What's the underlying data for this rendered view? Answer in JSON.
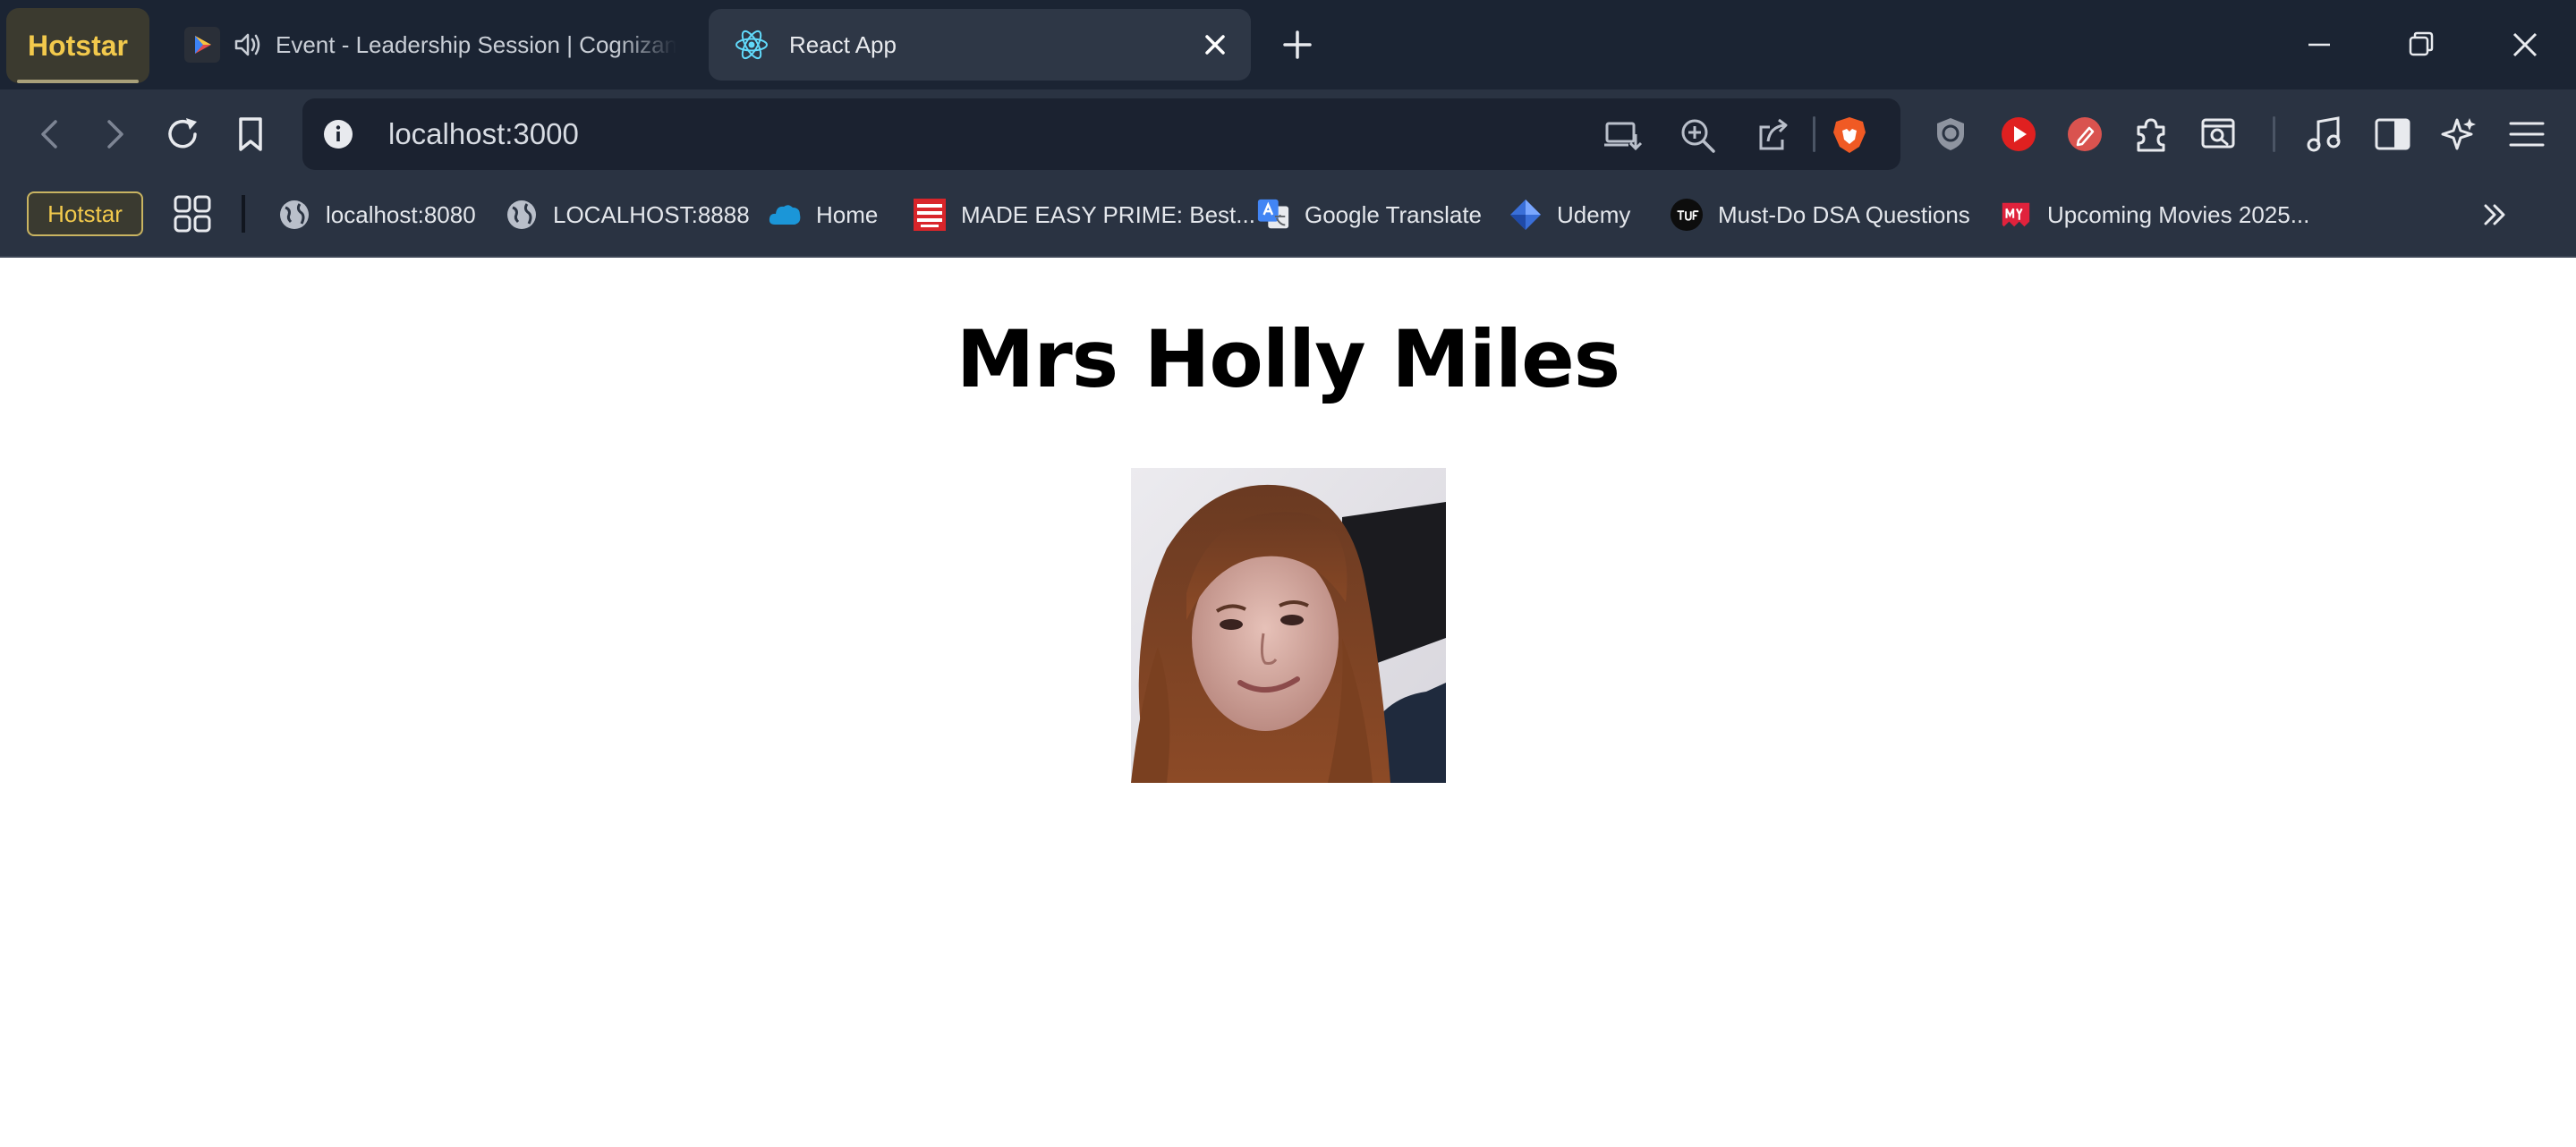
{
  "browser": {
    "pinned_tab": {
      "label": "Hotstar"
    },
    "tabs": [
      {
        "title": "Event - Leadership Session | Cognizant-E",
        "audio": true,
        "active": false
      },
      {
        "title": "React App",
        "active": true
      }
    ],
    "address_bar": {
      "url": "localhost:3000"
    },
    "bookmarks": {
      "pinned": "Hotstar",
      "items": [
        {
          "label": "localhost:8080",
          "icon": "globe-icon"
        },
        {
          "label": "LOCALHOST:8888",
          "icon": "globe-icon"
        },
        {
          "label": "Home",
          "icon": "salesforce-cloud-icon"
        },
        {
          "label": "MADE EASY PRIME: Best...",
          "icon": "made-easy-icon"
        },
        {
          "label": "Google Translate",
          "icon": "google-translate-icon"
        },
        {
          "label": "Udemy",
          "icon": "udemy-icon"
        },
        {
          "label": "Must-Do DSA Questions",
          "icon": "tuf-icon"
        },
        {
          "label": "Upcoming Movies 2025...",
          "icon": "my-icon"
        }
      ]
    },
    "colors": {
      "frame": "#1b2433",
      "toolbar": "#2a3342",
      "accent": "#f2c94c"
    }
  },
  "page": {
    "heading": "Mrs Holly Miles"
  }
}
